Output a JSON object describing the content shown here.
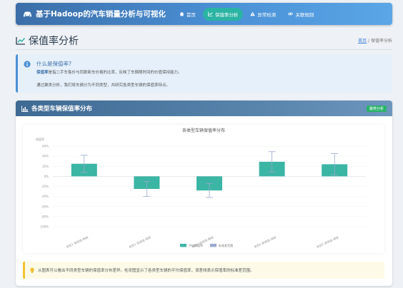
{
  "nav": {
    "brand": "基于Hadoop的汽车销量分析与可视化",
    "items": [
      {
        "label": "首页",
        "icon": "home-icon",
        "active": false
      },
      {
        "label": "保值率分析",
        "icon": "line-chart-icon",
        "active": true
      },
      {
        "label": "异常检测",
        "icon": "warning-icon",
        "active": false
      },
      {
        "label": "关联规则",
        "icon": "link-icon",
        "active": false
      }
    ]
  },
  "page": {
    "title": "保值率分析",
    "breadcrumb": {
      "home": "首页",
      "separator": "/",
      "current": "保值率分析"
    }
  },
  "info": {
    "question": "什么是保值率?",
    "term": "保值率",
    "definition": "是指二手车售价与同款新车价格的比率，反映了车辆随时间的价值保持能力。",
    "description": "通过聚类分析，我们将车辆分为不同类型，并研究各类型车辆的保值率特点。"
  },
  "card": {
    "title": "各类型车辆保值率分布",
    "badge": "聚类分析"
  },
  "note": {
    "text": "从图表可以看出不同类型车辆的保值率分布差异。柱状图显示了各类型车辆的平均保值率，误差线表示保值率的标准差范围。"
  },
  "colors": {
    "bar": "#3bb5a4",
    "error_bar": "#9aa8cc",
    "accent": "#4a90d6"
  },
  "chart_data": {
    "type": "bar",
    "title": "各类型车辆保值率分布",
    "ylabel": "保值率",
    "categories": [
      "类型1 高保值-畅销",
      "类型2 低保值-滞销",
      "类型3 低保值-畅销",
      "类型4 高保值-滞销",
      "类型5 高保值-滞销"
    ],
    "series": [
      {
        "name": "平均保值率",
        "values": [
          25,
          -25,
          -28,
          29,
          24
        ]
      },
      {
        "name": "标准差范围",
        "values": [
          17,
          15,
          14,
          20,
          21
        ]
      }
    ],
    "yticks": [
      "60%",
      "40%",
      "20%",
      "0%",
      "-20%",
      "-40%",
      "-60%",
      "-80%",
      "-100%"
    ],
    "ylim": [
      -100,
      60
    ],
    "grid": true,
    "legend": "bottom"
  }
}
